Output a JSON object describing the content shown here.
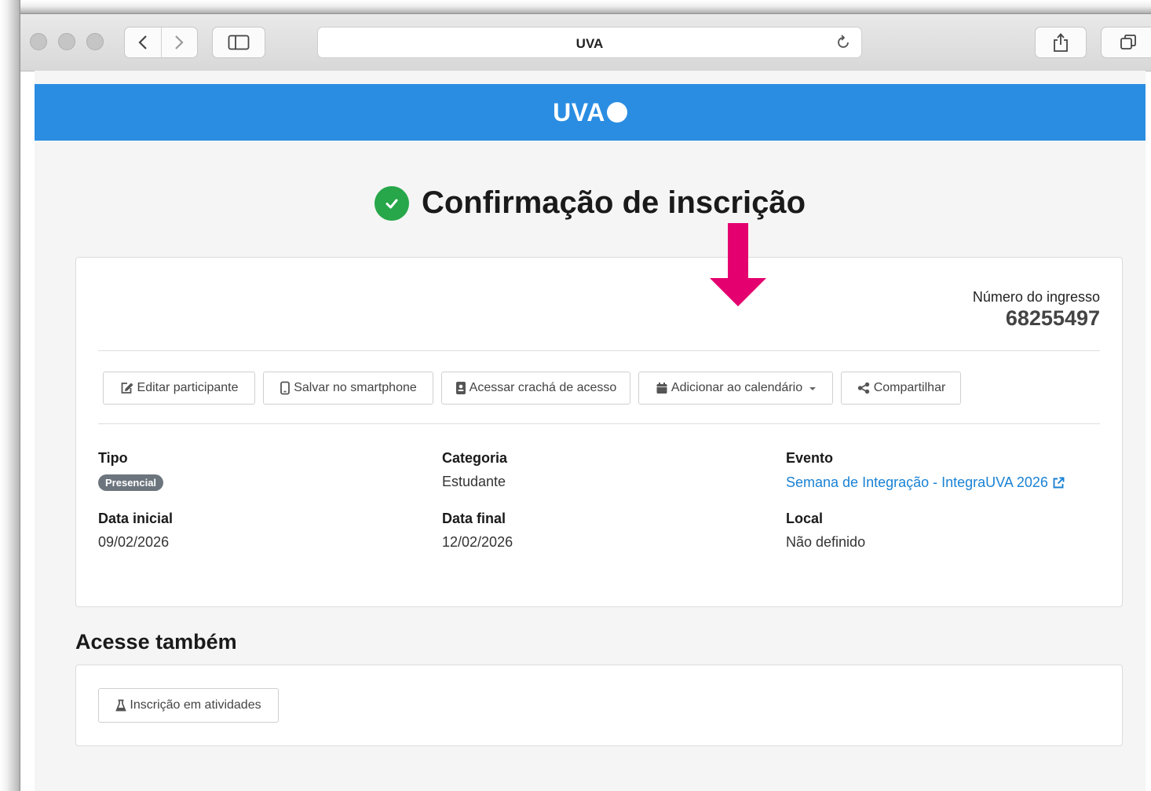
{
  "browser": {
    "address_text": "UVA"
  },
  "site": {
    "logo_text": "UVA"
  },
  "page": {
    "title": "Confirmação de inscrição"
  },
  "ticket": {
    "label": "Número do ingresso",
    "number": "68255497"
  },
  "actions": {
    "edit": "Editar participante",
    "save_phone": "Salvar no smartphone",
    "badge_access": "Acessar crachá de acesso",
    "calendar": "Adicionar ao calendário",
    "share": "Compartilhar"
  },
  "details": {
    "tipo_label": "Tipo",
    "tipo_value": "Presencial",
    "categoria_label": "Categoria",
    "categoria_value": "Estudante",
    "evento_label": "Evento",
    "evento_value": "Semana de Integração - IntegraUVA 2026",
    "data_inicial_label": "Data inicial",
    "data_inicial_value": "09/02/2026",
    "data_final_label": "Data final",
    "data_final_value": "12/02/2026",
    "local_label": "Local",
    "local_value": "Não definido"
  },
  "also": {
    "title": "Acesse também",
    "activities_button": "Inscrição em atividades"
  },
  "colors": {
    "header": "#2a8de2",
    "success": "#27a74a",
    "link": "#1a82d4",
    "annotation_arrow": "#e4006f",
    "badge": "#6c757d"
  }
}
